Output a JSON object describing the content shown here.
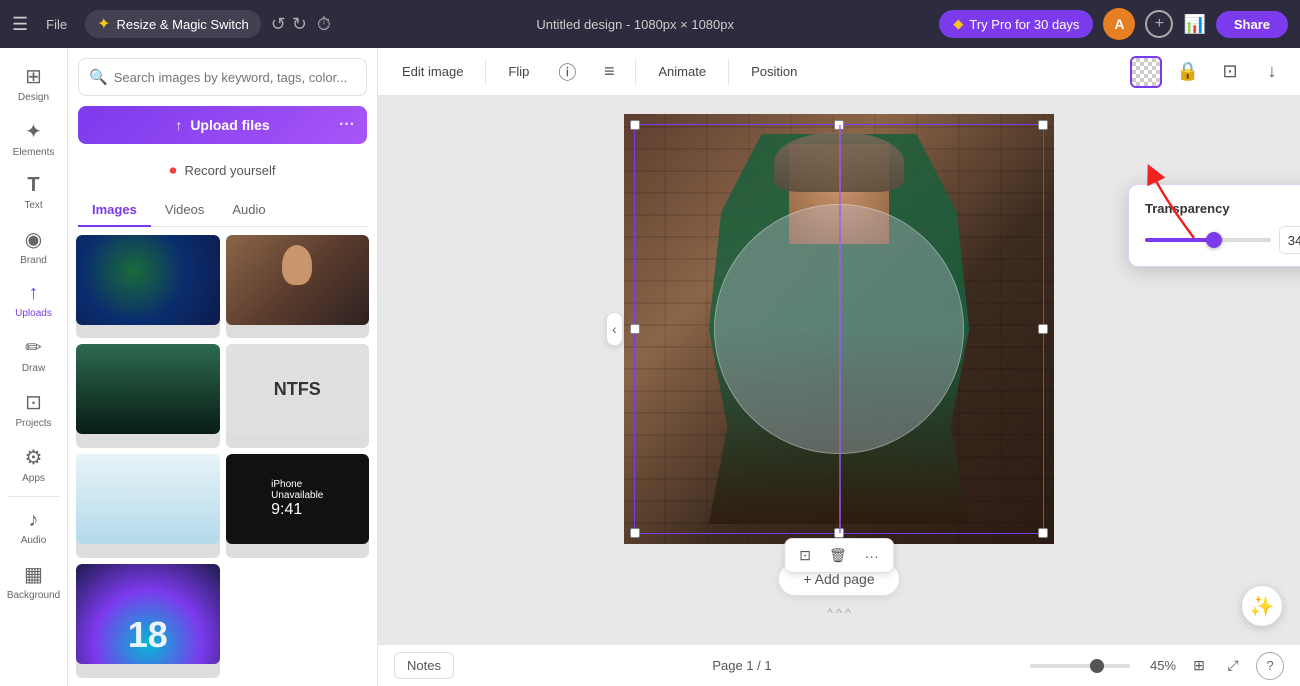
{
  "topbar": {
    "menu_icon": "☰",
    "file_label": "File",
    "magic_switch_label": "Resize & Magic Switch",
    "magic_star": "✦",
    "title": "Untitled design - 1080px × 1080px",
    "try_pro_label": "Try Pro for 30 days",
    "diamond_icon": "◆",
    "share_label": "Share",
    "avatar_initial": "A",
    "undo_icon": "↺",
    "redo_icon": "↻",
    "timer_icon": "⏱"
  },
  "sidebar": {
    "items": [
      {
        "id": "design",
        "label": "Design",
        "icon": "⊞"
      },
      {
        "id": "elements",
        "label": "Elements",
        "icon": "✦"
      },
      {
        "id": "text",
        "label": "Text",
        "icon": "T"
      },
      {
        "id": "brand",
        "label": "Brand",
        "icon": "◉"
      },
      {
        "id": "uploads",
        "label": "Uploads",
        "icon": "↑"
      },
      {
        "id": "draw",
        "label": "Draw",
        "icon": "✏"
      },
      {
        "id": "projects",
        "label": "Projects",
        "icon": "⊡"
      },
      {
        "id": "apps",
        "label": "Apps",
        "icon": "⚙"
      },
      {
        "id": "audio",
        "label": "Audio",
        "icon": "♪"
      },
      {
        "id": "background",
        "label": "Background",
        "icon": "▦"
      }
    ]
  },
  "left_panel": {
    "search_placeholder": "Search images by keyword, tags, color...",
    "upload_label": "Upload files",
    "more_icon": "···",
    "record_label": "Record yourself",
    "record_icon": "⏺",
    "tabs": [
      "Images",
      "Videos",
      "Audio"
    ],
    "active_tab": "Images"
  },
  "canvas_toolbar": {
    "edit_image_label": "Edit image",
    "flip_label": "Flip",
    "info_icon": "ⓘ",
    "more_icon": "≡",
    "animate_label": "Animate",
    "position_label": "Position",
    "lock_icon": "🔒",
    "copy_icon": "⊡",
    "download_icon": "↓"
  },
  "transparency_popup": {
    "title": "Transparency",
    "value": "34",
    "slider_percent": 55
  },
  "canvas": {
    "rotate_icon": "↻",
    "mini_toolbar": {
      "copy_icon": "⊡",
      "delete_icon": "🗑",
      "more_icon": "···"
    }
  },
  "bottom_bar": {
    "notes_label": "Notes",
    "page_info": "Page 1 / 1",
    "zoom_percent": "45%",
    "chevron_up_icon": "^",
    "grid_icon": "⊞",
    "expand_icon": "⤢",
    "help_icon": "?"
  }
}
